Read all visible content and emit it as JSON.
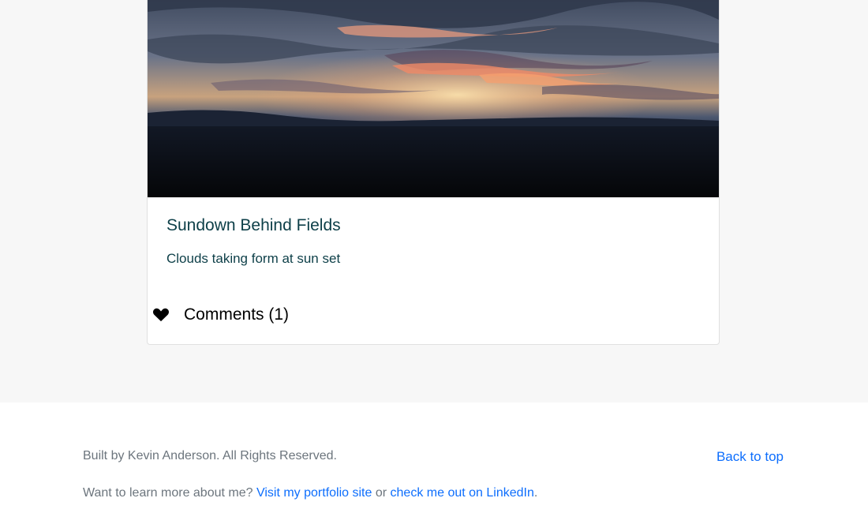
{
  "card": {
    "image_alt": "Sunset over fields with dramatic clouds",
    "title": "Sundown Behind Fields",
    "description": "Clouds taking form at sun set",
    "comments_label": "Comments (1)"
  },
  "footer": {
    "credit": "Built by Kevin Anderson. All Rights Reserved.",
    "back_to_top": "Back to top",
    "learn_prefix": "Want to learn more about me?",
    "portfolio_link": "Visit my portfolio site",
    "connector": "or",
    "linkedin_link": "check me out on LinkedIn",
    "trailing": "."
  },
  "icons": {
    "comments": "heart-icon"
  },
  "colors": {
    "page_background": "#f7f7f7",
    "title_text": "#0d3f48",
    "link": "#0d6efd",
    "muted_text": "#6c757d"
  }
}
